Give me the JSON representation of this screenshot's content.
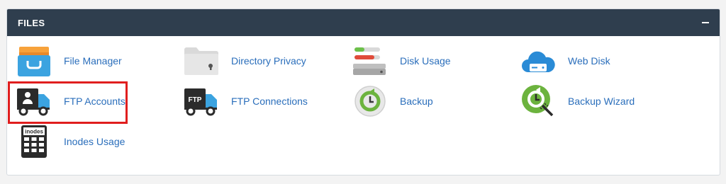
{
  "panel": {
    "title": "FILES",
    "collapse_icon": "minus-icon"
  },
  "items": [
    {
      "label": "File Manager",
      "icon": "file-manager-icon"
    },
    {
      "label": "Directory Privacy",
      "icon": "directory-privacy-icon"
    },
    {
      "label": "Disk Usage",
      "icon": "disk-usage-icon"
    },
    {
      "label": "Web Disk",
      "icon": "web-disk-icon"
    },
    {
      "label": "FTP Accounts",
      "icon": "ftp-accounts-icon"
    },
    {
      "label": "FTP Connections",
      "icon": "ftp-connections-icon"
    },
    {
      "label": "Backup",
      "icon": "backup-icon"
    },
    {
      "label": "Backup Wizard",
      "icon": "backup-wizard-icon"
    },
    {
      "label": "Inodes Usage",
      "icon": "inodes-usage-icon"
    }
  ],
  "icon_texts": {
    "ftp": "FTP",
    "inodes": "inodes"
  },
  "colors": {
    "header_bg": "#2f3e4e",
    "link": "#2a6ebb",
    "highlight": "#e01e1e"
  }
}
